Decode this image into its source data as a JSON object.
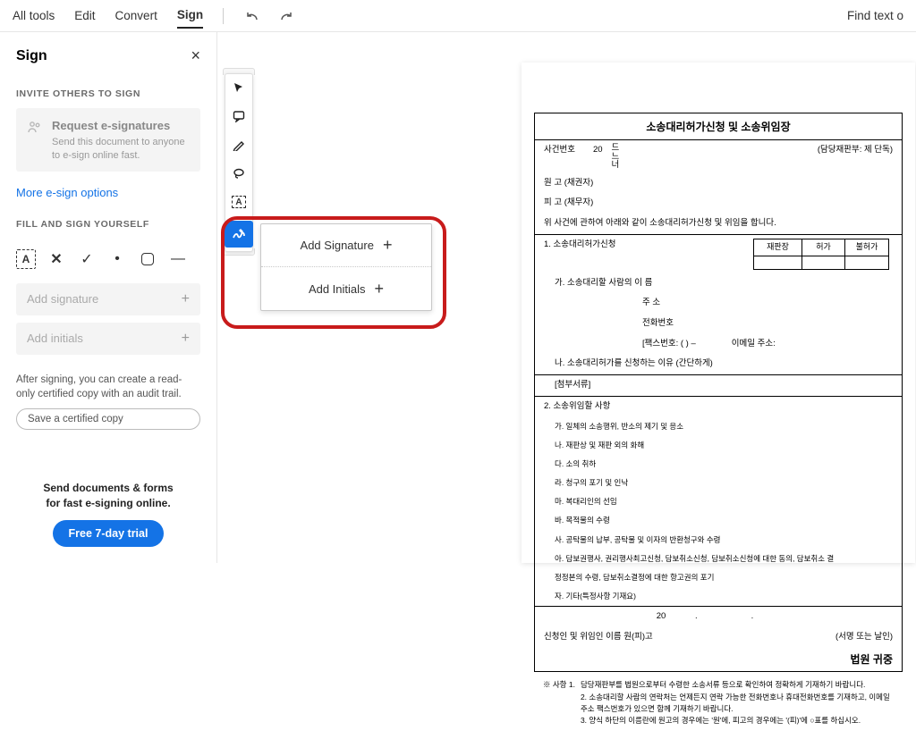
{
  "topbar": {
    "all_tools": "All tools",
    "edit": "Edit",
    "convert": "Convert",
    "sign": "Sign",
    "find_text": "Find text o"
  },
  "sidebar": {
    "title": "Sign",
    "invite_label": "INVITE OTHERS TO SIGN",
    "request_title": "Request e-signatures",
    "request_sub": "Send this document to anyone to e-sign online fast.",
    "more_link": "More e-sign options",
    "fill_label": "FILL AND SIGN YOURSELF",
    "add_sig": "Add signature",
    "add_init": "Add initials",
    "note": "After signing, you can create a read-only certified copy with an audit trail.",
    "save_copy": "Save a certified copy",
    "promo1": "Send documents & forms",
    "promo2": "for fast e-signing online.",
    "trial": "Free 7-day trial"
  },
  "popover": {
    "add_sig": "Add Signature",
    "add_init": "Add Initials"
  },
  "doc": {
    "title": "소송대리허가신청 및 소송위임장",
    "row_case": "사건번호",
    "row_case_num": "20",
    "hangul_stack": "드느너",
    "dept": "(담당재판부: 제      단독)",
    "plaintiff": "원    고 (채권자)",
    "defendant": "피    고 (채무자)",
    "intro": "위 사건에 관하여 아래와 같이 소송대리허가신청 및 위임을 합니다.",
    "s1": "1. 소송대리허가신청",
    "sub_h1": "허가",
    "sub_h2": "불허가",
    "sub_l": "재판장",
    "s1a_label": "가. 소송대리할 사람의 이 름",
    "s1a_addr": "주 소",
    "s1a_tel": "전화번호",
    "s1a_fax": "[팩스번호: (    )      –",
    "s1a_email": "이메일 주소:",
    "s1b": "나. 소송대리허가를 신청하는 이유  (간단하게)",
    "attach": "[첨부서류]",
    "s2": "2. 소송위임할 사항",
    "s2a": "가. 일체의 소송행위, 반소의 제기 및 응소",
    "s2b": "나. 재판상 및 재판 외의 화해",
    "s2c": "다. 소의 취하",
    "s2d": "라. 청구의 포기 및 인낙",
    "s2e": "마. 복대리인의 선임",
    "s2f": "바. 목적물의 수령",
    "s2g": "사. 공탁물의 납부, 공탁물 및 이자의 반환청구와 수령",
    "s2h": "아. 담보권행사, 권리행사최고신청, 담보취소신청, 담보취소신청에 대한 동의, 담보취소 결",
    "s2h2": "    정정본의 수령, 담보취소결정에 대한 항고권의 포기",
    "s2i": "자. 기타(특정사항 기재요)",
    "date_year": "20",
    "signer": "신청인 및 위임인 이름 원(피)고",
    "signer_note": "(서명 또는 날인)",
    "court": "법원 귀중",
    "footnote_t": "※ 사항 1.",
    "fn1": "담당재판부를 법원으로부터 수령한 소송서류 등으로 확인하여 정확하게 기재하기 바랍니다.",
    "fn2": "2. 소송대리할 사람의 연락처는 언제든지 연락 가능한 전화번호나 휴대전화번호를 기재하고, 이메일 주소 팩스번호가 있으면 함께 기재하기 바랍니다.",
    "fn3": "3. 양식 하단의 이름란에 원고의 경우에는 '원'에, 피고의 경우에는 '(피)'에 ○표를 하십시오."
  }
}
